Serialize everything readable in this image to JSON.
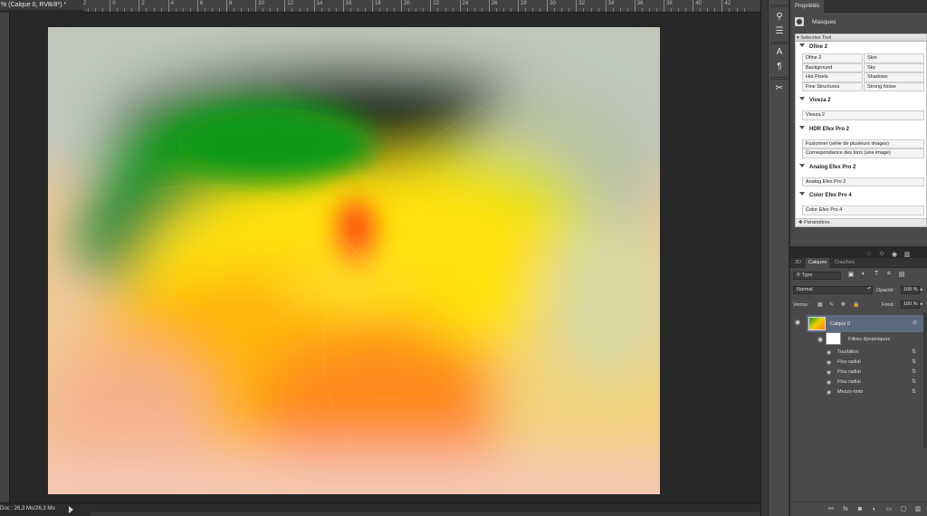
{
  "document": {
    "tab_title": "% (Calque 0, RVB/8*) *"
  },
  "ruler": {
    "ticks": [
      "2",
      "0",
      "2",
      "4",
      "6",
      "8",
      "10",
      "12",
      "14",
      "16",
      "18",
      "20",
      "22",
      "24",
      "26",
      "28",
      "30",
      "32",
      "34",
      "36",
      "38",
      "40",
      "42"
    ]
  },
  "status": {
    "doc_size": "Doc : 26,3 Mo/26,3 Mo"
  },
  "toolbar": {
    "tools": [
      "history-brush-icon",
      "adjustments-icon",
      "character-icon",
      "paragraph-icon",
      "tools-scissors-icon"
    ]
  },
  "properties": {
    "tab": "Propriétés",
    "masks_label": "Masques"
  },
  "selective_tool": {
    "title": "Selective Tool",
    "dfine": {
      "header": "Dfine 2",
      "buttons": [
        "Dfine 2",
        "Skin",
        "Background",
        "Sky",
        "Hot Pixels",
        "Shadows",
        "Fine Structures",
        "Strong Noise"
      ]
    },
    "viveza": {
      "header": "Viveza 2",
      "button": "Viveza 2"
    },
    "hdr": {
      "header": "HDR Efex Pro 2",
      "buttons": [
        "Fusionner (série de plusieurs images)",
        "Correspondance des tons (une image)"
      ]
    },
    "analog": {
      "header": "Analog Efex Pro 2",
      "button": "Analog Efex Pro 2"
    },
    "color": {
      "header": "Color Efex Pro 4",
      "button": "Color Efex Pro 4"
    },
    "footer": "Paramètres"
  },
  "layers": {
    "tabs": [
      "3D",
      "Calques",
      "Couches"
    ],
    "filter_type": "Type",
    "blend_mode": "Normal",
    "opacity_label": "Opacité :",
    "opacity_value": "100 %",
    "lock_label": "Verrou :",
    "fill_label": "Fond :",
    "fill_value": "100 %",
    "layer_name": "Calque 0",
    "smart_filters_label": "Filtres dynamiques",
    "filters": [
      "Tourbillon",
      "Flou radial",
      "Flou radial",
      "Flou radial",
      "Mezzo-tinto"
    ]
  },
  "colors": {
    "panel": "#4a4a4a",
    "selected_layer": "#5d6a7e",
    "canvas_bg": "#282828"
  }
}
